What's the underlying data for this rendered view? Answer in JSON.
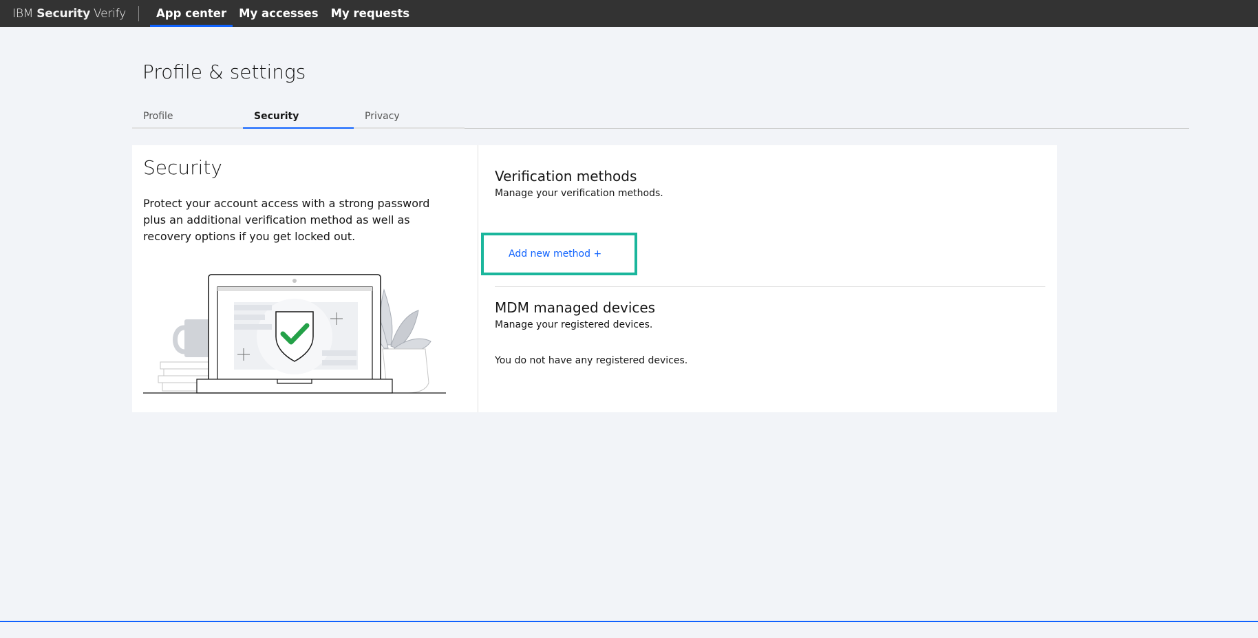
{
  "header": {
    "brand_ibm": "IBM",
    "brand_security": "Security",
    "brand_verify": "Verify",
    "nav": [
      {
        "label": "App center",
        "active": true
      },
      {
        "label": "My accesses",
        "active": false
      },
      {
        "label": "My requests",
        "active": false
      }
    ]
  },
  "page": {
    "title": "Profile & settings"
  },
  "tabs": [
    {
      "label": "Profile",
      "active": false
    },
    {
      "label": "Security",
      "active": true
    },
    {
      "label": "Privacy",
      "active": false
    }
  ],
  "security": {
    "heading": "Security",
    "description": "Protect your account access with a strong password plus an additional verification method as well as recovery options if you get locked out."
  },
  "verification": {
    "title": "Verification methods",
    "subtitle": "Manage your verification methods.",
    "add_label": "Add new method +"
  },
  "mdm": {
    "title": "MDM managed devices",
    "subtitle": "Manage your registered devices.",
    "empty": "You do not have any registered devices."
  },
  "colors": {
    "header_bg": "#333333",
    "accent": "#0f62fe",
    "highlight": "#1ab69c",
    "page_bg": "#f2f4f8",
    "check": "#24a148"
  }
}
